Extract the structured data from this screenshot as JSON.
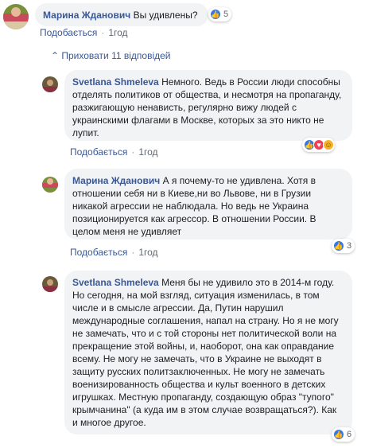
{
  "comments": [
    {
      "author": "Марина Жданович",
      "text": "Вы удивлены?",
      "reaction_count": "5",
      "like_label": "Подобається",
      "time": "1год"
    },
    {
      "author": "Svetlana Shmeleva",
      "text": "Немного. Ведь в России люди способны отделять политиков от общества, и несмотря на пропаганду, разжигающую ненависть, регулярно вижу людей с украинскими флагами в Москве, которых за это никто не лупит.",
      "like_label": "Подобається",
      "time": "1год"
    },
    {
      "author": "Марина Жданович",
      "text": "А я почему-то не удивлена. Хотя в отношении себя ни в Киеве,ни во Львове, ни в Грузии никакой агрессии не наблюдала. Но ведь не Украина позиционируется как агрессор. В отношении России. В целом меня не удивляет",
      "reaction_count": "3",
      "like_label": "Подобається",
      "time": "1год"
    },
    {
      "author": "Svetlana Shmeleva",
      "text": "Меня бы не удивило это в 2014-м году. Но сегодня, на мой взгляд, ситуация изменилась, в том числе и в смысле агрессии. Да, Путин нарушил международные соглашения, напал на страну. Но я не могу не замечать, что и с той стороны нет политической воли на прекращение этой войны, и, наоборот, она как оправдание всему. Не могу не замечать, что в Украине не выходят в защиту русских политзаключенных. Не могу не замечать военизированность общества и культ военного в детских игрушках. Местную пропаганду, создающую образ \"тупого\" крымчанина\" (а куда им в этом случае возвращаться?). Как и многое другое.",
      "reaction_count": "6",
      "like_label": "Подобається",
      "time": "1год"
    }
  ],
  "hide_replies": "Приховати 11 відповідей",
  "colors": {
    "link": "#385898",
    "bubble": "#f2f3f5",
    "like": "#3578e5",
    "love": "#f33e58",
    "haha": "#f7b125"
  },
  "icons": [
    "like-icon",
    "love-icon",
    "haha-icon",
    "chevron-up-icon",
    "avatar"
  ]
}
